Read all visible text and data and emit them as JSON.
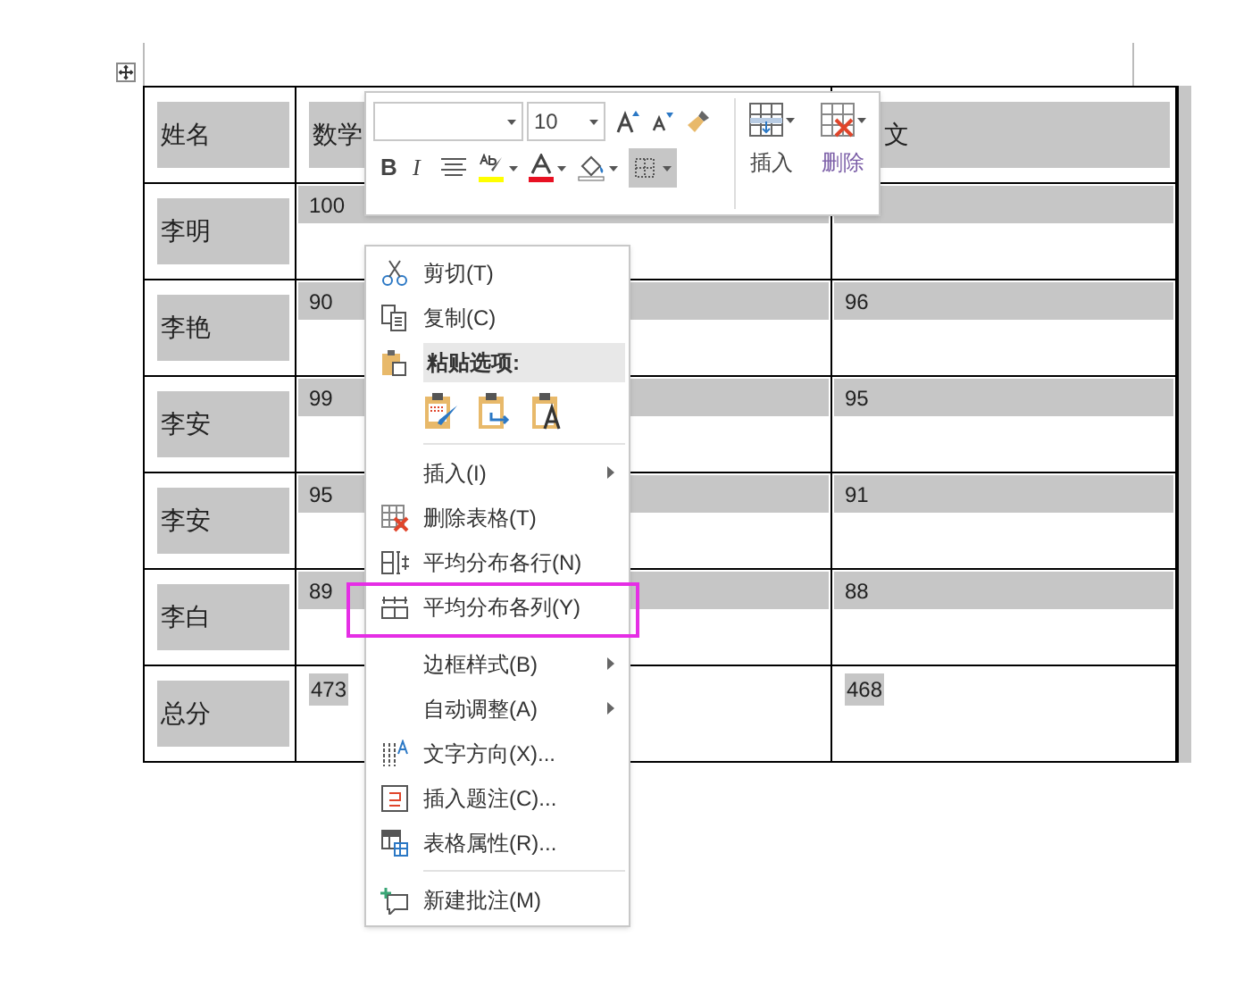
{
  "table": {
    "selected": true,
    "header": [
      "姓名",
      "数学",
      "文"
    ],
    "rows": [
      {
        "kind": "normal",
        "cells": [
          "李明",
          "100"
        ]
      },
      {
        "kind": "normal",
        "cells": [
          "李艳",
          "90",
          "96"
        ]
      },
      {
        "kind": "normal",
        "cells": [
          "李安",
          "99",
          "95"
        ]
      },
      {
        "kind": "normal",
        "cells": [
          "李安",
          "95",
          "91"
        ]
      },
      {
        "kind": "normal",
        "cells": [
          "李白",
          "89",
          "88"
        ]
      },
      {
        "kind": "total",
        "cells": [
          "总分",
          "473",
          "468"
        ]
      }
    ]
  },
  "mini_toolbar": {
    "size_field": {
      "value": "10"
    },
    "bold_label": "B",
    "italic_label": "I",
    "border_button": {
      "selected": true
    },
    "insert_label": "插入",
    "delete_label": "删除"
  },
  "context_menu": [
    {
      "kind": "item",
      "label": "剪切(T)",
      "submenu": false,
      "highlighted": false
    },
    {
      "kind": "item",
      "label": "复制(C)",
      "submenu": false,
      "highlighted": false
    },
    {
      "kind": "heading",
      "label": "粘贴选项:"
    },
    {
      "kind": "paste_options"
    },
    {
      "kind": "separator"
    },
    {
      "kind": "item",
      "label": "插入(I)",
      "submenu": true,
      "highlighted": false
    },
    {
      "kind": "item",
      "label": "删除表格(T)",
      "submenu": false,
      "highlighted": false
    },
    {
      "kind": "item",
      "label": "平均分布各行(N)",
      "submenu": false,
      "highlighted": false
    },
    {
      "kind": "item",
      "label": "平均分布各列(Y)",
      "submenu": false,
      "highlighted": true
    },
    {
      "kind": "separator"
    },
    {
      "kind": "item",
      "label": "边框样式(B)",
      "submenu": true,
      "highlighted": false
    },
    {
      "kind": "item",
      "label": "自动调整(A)",
      "submenu": true,
      "highlighted": false
    },
    {
      "kind": "item",
      "label": "文字方向(X)...",
      "submenu": false,
      "highlighted": false
    },
    {
      "kind": "item",
      "label": "插入题注(C)...",
      "submenu": false,
      "highlighted": false
    },
    {
      "kind": "item",
      "label": "表格属性(R)...",
      "submenu": false,
      "highlighted": false
    },
    {
      "kind": "separator"
    },
    {
      "kind": "item",
      "label": "新建批注(M)",
      "submenu": false,
      "highlighted": false
    }
  ]
}
